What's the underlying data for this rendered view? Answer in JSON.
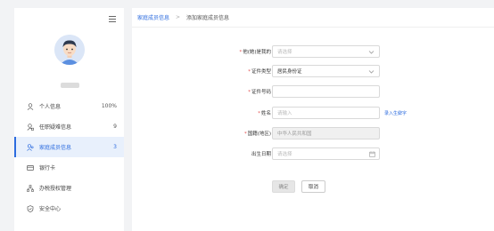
{
  "sidebar": {
    "items": [
      {
        "label": "个人信息",
        "count": "100%",
        "icon": "user-icon",
        "active": false
      },
      {
        "label": "任职疑难信息",
        "count": "9",
        "icon": "user-badge-icon",
        "active": false
      },
      {
        "label": "家庭成员信息",
        "count": "3",
        "icon": "family-icon",
        "active": true
      },
      {
        "label": "银行卡",
        "count": "",
        "icon": "bank-card-icon",
        "active": false
      },
      {
        "label": "办税授权管理",
        "count": "",
        "icon": "org-chart-icon",
        "active": false
      },
      {
        "label": "安全中心",
        "count": "",
        "icon": "shield-icon",
        "active": false
      }
    ]
  },
  "breadcrumb": {
    "parent": "家庭成员信息",
    "separator": ">",
    "current": "添加家庭成员信息"
  },
  "form": {
    "relation": {
      "label": "他(她)是我的",
      "placeholder": "请选择"
    },
    "id_type": {
      "label": "证件类型",
      "value": "居民身份证"
    },
    "id_number": {
      "label": "证件号码",
      "value": ""
    },
    "name": {
      "label": "姓名",
      "placeholder": "请输入",
      "extra_link": "录入生僻字"
    },
    "nationality": {
      "label": "国籍(地区)",
      "value": "中华人民共和国"
    },
    "birth_date": {
      "label": "出生日期",
      "placeholder": "请选择"
    }
  },
  "buttons": {
    "confirm": "确定",
    "cancel": "取消"
  },
  "colors": {
    "accent": "#2d6cdf",
    "required": "#e34d4d"
  }
}
